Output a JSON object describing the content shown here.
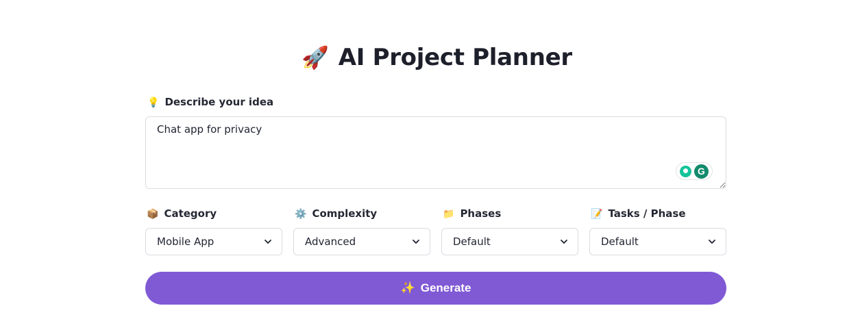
{
  "header": {
    "emoji": "🚀",
    "title": "AI Project Planner"
  },
  "idea": {
    "emoji": "💡",
    "label": "Describe your idea",
    "value": "Chat app for privacy"
  },
  "fields": [
    {
      "emoji": "📦",
      "label": "Category",
      "value": "Mobile App"
    },
    {
      "emoji": "⚙️",
      "label": "Complexity",
      "value": "Advanced"
    },
    {
      "emoji": "📁",
      "label": "Phases",
      "value": "Default"
    },
    {
      "emoji": "📝",
      "label": "Tasks / Phase",
      "value": "Default"
    }
  ],
  "generate": {
    "emoji": "✨",
    "label": "Generate"
  },
  "colors": {
    "accent": "#805ad5",
    "grammarly": "#15c39a"
  }
}
